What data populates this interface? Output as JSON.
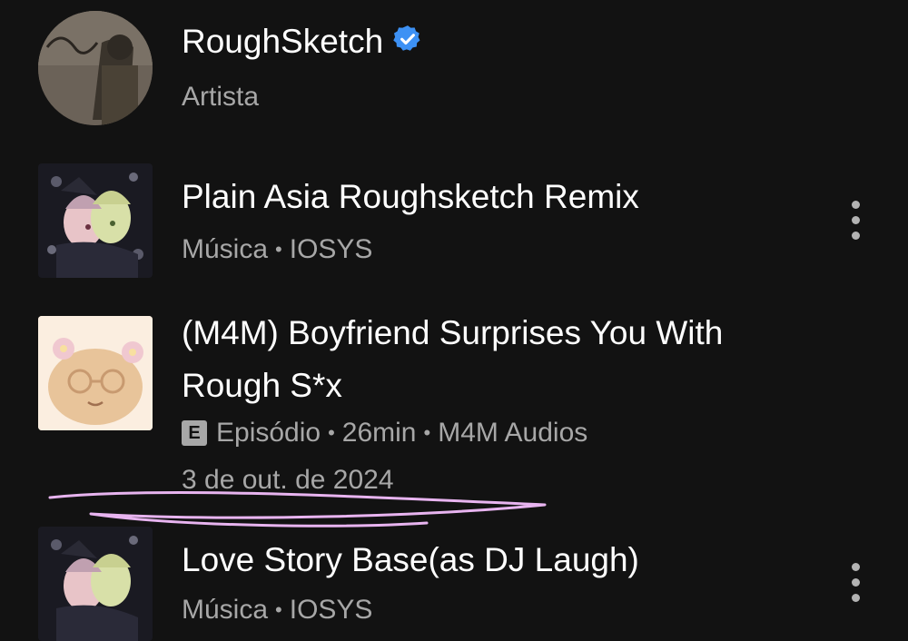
{
  "results": [
    {
      "kind": "artist",
      "title": "RoughSketch",
      "verified": true,
      "subtitle": "Artista",
      "image": "artist-photo"
    },
    {
      "kind": "song",
      "title": "Plain Asia Roughsketch Remix",
      "type_label": "Música",
      "artist": "IOSYS",
      "image": "album-art-anime"
    },
    {
      "kind": "episode",
      "title_line1": "(M4M) Boyfriend Surprises You With",
      "title_line2": "Rough S*x",
      "explicit_badge": "E",
      "type_label": "Episódio",
      "duration": "26min",
      "show": "M4M Audios",
      "date": "3 de out. de 2024",
      "image": "podcast-cover-bear"
    },
    {
      "kind": "song",
      "title": "Love Story Base(as DJ Laugh)",
      "type_label": "Música",
      "artist": "IOSYS",
      "image": "album-art-anime"
    }
  ],
  "separator": "•",
  "colors": {
    "background": "#121212",
    "primary_text": "#ffffff",
    "secondary_text": "#a7a7a7",
    "verified_blue": "#3d91f4",
    "annotation_scribble": "#e8b4f0"
  }
}
